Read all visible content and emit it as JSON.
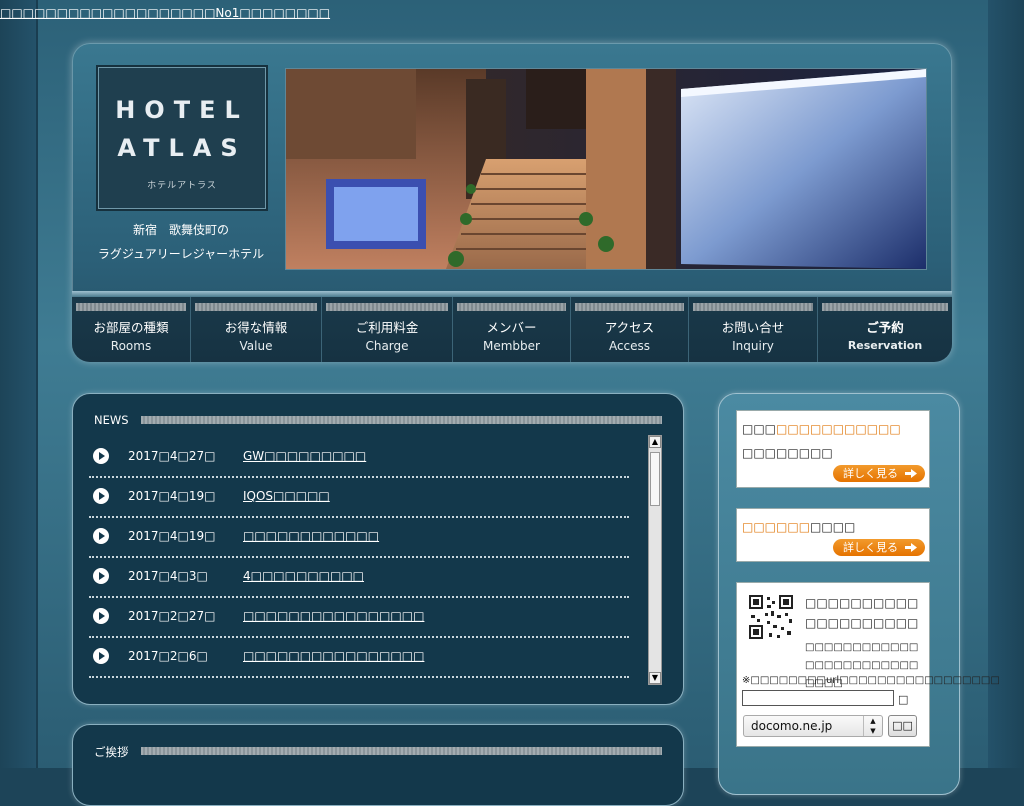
{
  "top_link": "□□□□□□□□□□□□□□□□□□□No1□□□□□□□□",
  "header": {
    "logo_line1": "HOTEL",
    "logo_line2": "ATLAS",
    "logo_sub": "ホテルアトラス",
    "tagline1": "新宿　歌舞伎町の",
    "tagline2": "ラグジュアリーレジャーホテル"
  },
  "nav": [
    {
      "jp": "お部屋の種類",
      "en": "Rooms"
    },
    {
      "jp": "お得な情報",
      "en": "Value"
    },
    {
      "jp": "ご利用料金",
      "en": "Charge"
    },
    {
      "jp": "メンバー",
      "en": "Membber"
    },
    {
      "jp": "アクセス",
      "en": "Access"
    },
    {
      "jp": "お問い合せ",
      "en": "Inquiry"
    },
    {
      "jp": "ご予約",
      "en": "Reservation"
    }
  ],
  "news": {
    "title": "NEWS",
    "items": [
      {
        "date": "2017□4□27□",
        "text": "GW□□□□□□□□□"
      },
      {
        "date": "2017□4□19□",
        "text": "IQOS□□□□□"
      },
      {
        "date": "2017□4□19□",
        "text": "□□□□□□□□□□□□"
      },
      {
        "date": "2017□4□3□",
        "text": "4□□□□□□□□□□"
      },
      {
        "date": "2017□2□27□",
        "text": "□□□□□□□□□□□□□□□□"
      },
      {
        "date": "2017□2□6□",
        "text": "□□□□□□□□□□□□□□□□"
      }
    ]
  },
  "greeting": {
    "title": "ご挨拶"
  },
  "side": {
    "card1_line1_a": "□□□",
    "card1_line1_b": "□□□□□□□□□□□",
    "card1_line2": "□□□□□□□□",
    "card2_line1_a": "□□□□□□",
    "card2_line1_b": "□□□□",
    "more_label": "詳しく見る",
    "mobile_title": "□□□□□□□□□□□□□□□□□□□□",
    "mobile_note1": "□□□□□□□□□□□□□□□□□□□□□□□□□□□□",
    "mobile_note2": "※□□□□□□□□url□□□□□□□□□□□□□□□□□",
    "at": "□",
    "domain_value": "docomo.ne.jp",
    "send_label": "□□"
  },
  "colors": {
    "accent_orange": "#e07a10",
    "bg_dark": "#1d4458",
    "panel_dark": "#13384b"
  }
}
